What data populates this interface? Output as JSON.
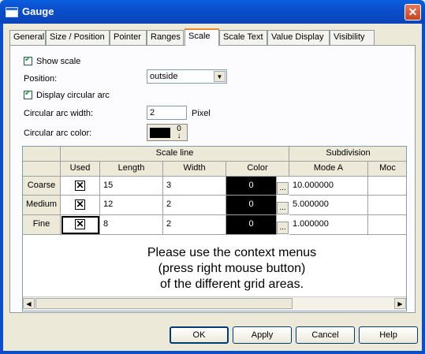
{
  "window": {
    "title": "Gauge",
    "close_glyph": "✕"
  },
  "tabs": [
    "General",
    "Size / Position",
    "Pointer",
    "Ranges",
    "Scale",
    "Scale Text",
    "Value Display",
    "Visibility"
  ],
  "active_tab": "Scale",
  "scale": {
    "show_scale_label": "Show scale",
    "show_scale_checked": true,
    "position_label": "Position:",
    "position_value": "outside",
    "display_arc_label": "Display circular arc",
    "display_arc_checked": true,
    "arc_width_label": "Circular arc width:",
    "arc_width_value": "2",
    "arc_width_unit": "Pixel",
    "arc_color_label": "Circular arc color:",
    "arc_color_value": "#000000",
    "color_dropdown_glyph": "0",
    "color_dropdown_arrow": "↓"
  },
  "grid": {
    "group_headers": {
      "scale_line": "Scale line",
      "subdivision": "Subdivision"
    },
    "columns": [
      "Used",
      "Length",
      "Width",
      "Color",
      "Mode A",
      "Moc"
    ],
    "rows": [
      {
        "name": "Coarse",
        "used": true,
        "length": "15",
        "width": "3",
        "color": "0",
        "mode_a": "10.000000"
      },
      {
        "name": "Medium",
        "used": true,
        "length": "12",
        "width": "2",
        "color": "0",
        "mode_a": "5.000000"
      },
      {
        "name": "Fine",
        "used": true,
        "length": "8",
        "width": "2",
        "color": "0",
        "mode_a": "1.000000"
      }
    ],
    "check_glyph": "✕",
    "ellipsis": "...",
    "message_lines": [
      "Please use the context menus",
      "(press right mouse button)",
      "of the different grid areas."
    ]
  },
  "buttons": {
    "ok": "OK",
    "apply": "Apply",
    "cancel": "Cancel",
    "help": "Help"
  },
  "icons": {
    "select_arrow": "▼",
    "scroll_left": "◀",
    "scroll_right": "▶"
  }
}
